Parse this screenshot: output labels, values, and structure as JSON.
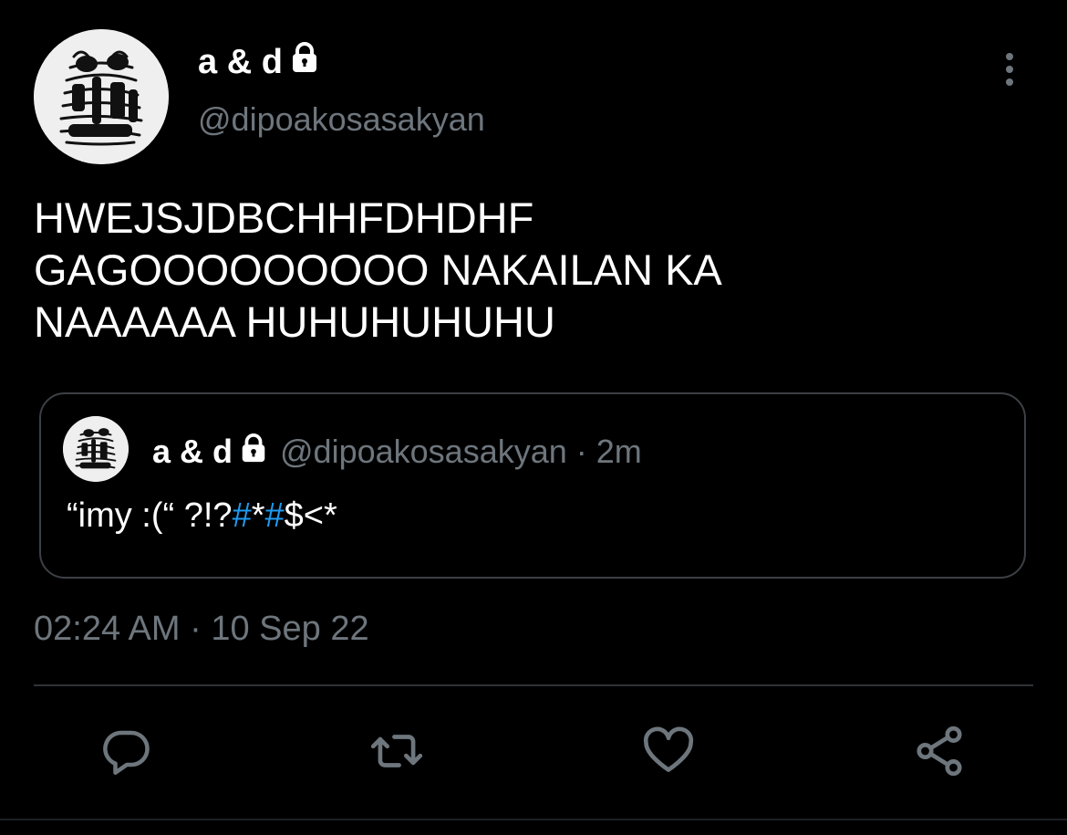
{
  "tweet": {
    "display_name": "a & d",
    "handle": "@dipoakosasakyan",
    "text_lines": [
      "HWEJSJDBCHHFDHDHF",
      "GAGOOOOOOOOO NAKAILAN KA",
      "NAAAAAA HUHUHUHUHU"
    ],
    "timestamp": "02:24 AM · 10 Sep 22"
  },
  "quote": {
    "display_name": "a & d",
    "handle": "@dipoakosasakyan",
    "separator": "·",
    "time": "2m",
    "text_prefix": "“imy :(“ ?!?",
    "hashtag_1": "#",
    "star_1": "*",
    "hashtag_2": "#",
    "text_suffix": "$<*"
  },
  "icons": {
    "lock": "lock-icon",
    "more": "more-vertical-icon",
    "reply": "reply-icon",
    "retweet": "retweet-icon",
    "like": "heart-icon",
    "share": "share-icon"
  },
  "colors": {
    "background": "#000000",
    "text": "#ffffff",
    "secondary": "#6e767d",
    "border": "#3c4045",
    "hashtag": "#1d9bf0"
  }
}
